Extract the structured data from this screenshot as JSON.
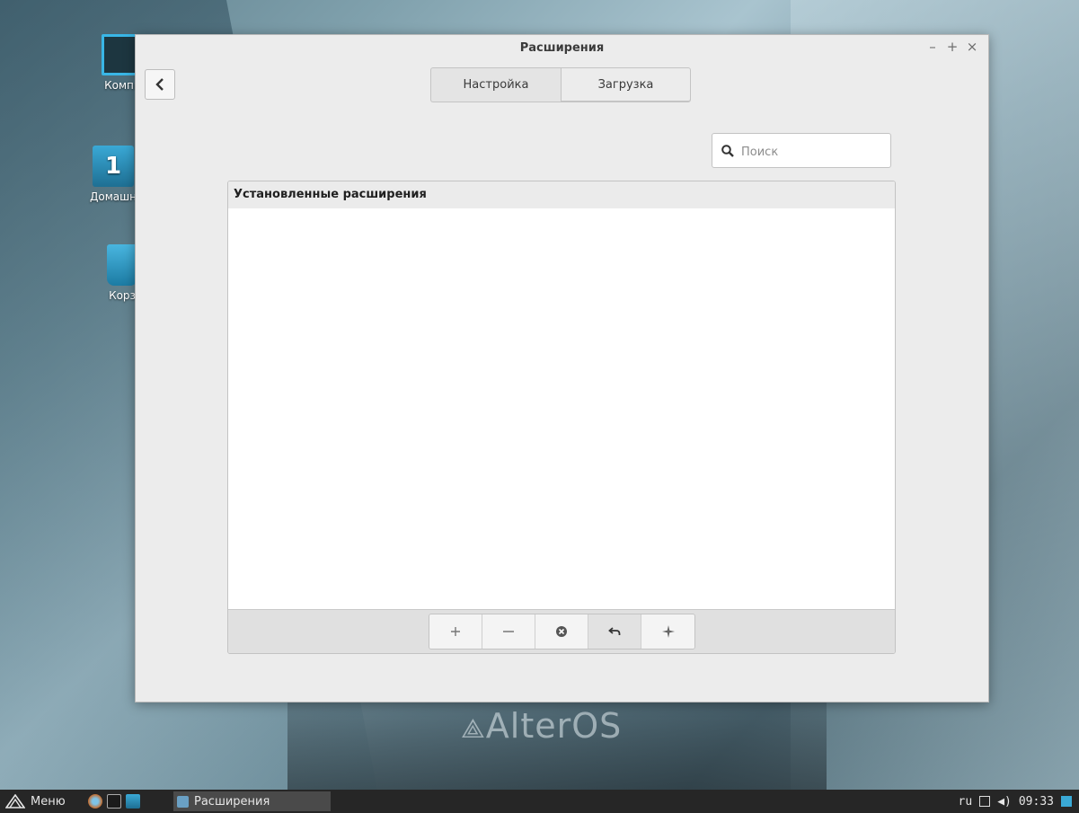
{
  "desktop": {
    "icons": [
      {
        "label": "Компь"
      },
      {
        "label": "Домашн"
      },
      {
        "label": "Корз"
      }
    ],
    "watermark": "AlterOS"
  },
  "window": {
    "title": "Расширения",
    "controls": {
      "minimize": "–",
      "maximize": "+",
      "close": "×"
    },
    "tabs": [
      {
        "label": "Настройка",
        "active": true
      },
      {
        "label": "Загрузка",
        "active": false
      }
    ],
    "search": {
      "placeholder": "Поиск",
      "value": ""
    },
    "list": {
      "header": "Установленные расширения",
      "items": []
    },
    "toolbar": {
      "buttons": [
        {
          "name": "add",
          "icon": "plus-icon"
        },
        {
          "name": "remove",
          "icon": "minus-icon"
        },
        {
          "name": "uninstall",
          "icon": "x-circle-icon"
        },
        {
          "name": "restore",
          "icon": "undo-icon"
        },
        {
          "name": "more",
          "icon": "sparkle-icon"
        }
      ]
    }
  },
  "taskbar": {
    "menu_label": "Меню",
    "active_task": "Расширения",
    "tray": {
      "lang": "ru",
      "clock": "09:33"
    }
  },
  "colors": {
    "accent": "#39b6e6",
    "taskbar": "#262626"
  }
}
